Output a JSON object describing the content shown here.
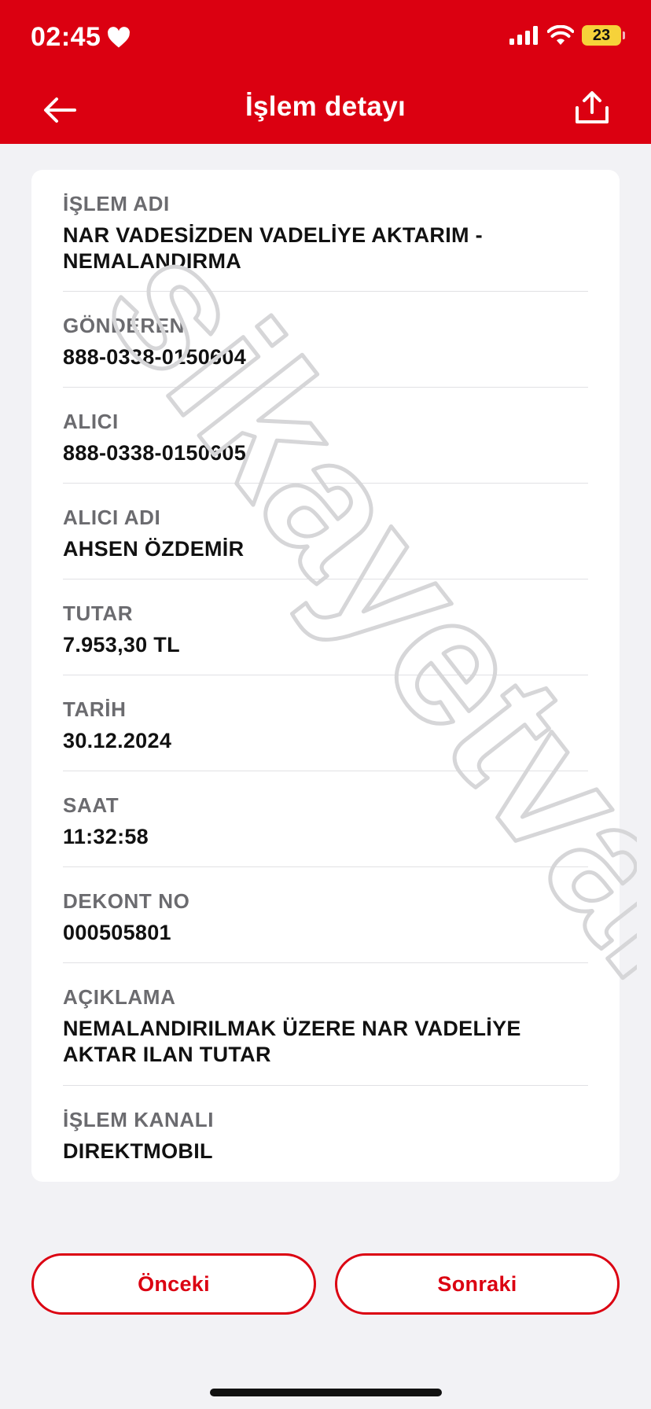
{
  "status_bar": {
    "time": "02:45",
    "battery": "23"
  },
  "header": {
    "title": "İşlem detayı"
  },
  "details": [
    {
      "label": "İŞLEM ADI",
      "value": "NAR VADESİZDEN VADELİYE AKTARIM -\nNEMALANDIRMA"
    },
    {
      "label": "GÖNDEREN",
      "value": "888-0338-0150604"
    },
    {
      "label": "ALICI",
      "value": "888-0338-0150605"
    },
    {
      "label": "ALICI ADI",
      "value": "AHSEN ÖZDEMİR"
    },
    {
      "label": "TUTAR",
      "value": "7.953,30 TL"
    },
    {
      "label": "TARİH",
      "value": "30.12.2024"
    },
    {
      "label": "SAAT",
      "value": "11:32:58"
    },
    {
      "label": "DEKONT NO",
      "value": "000505801"
    },
    {
      "label": "AÇIKLAMA",
      "value": "NEMALANDIRILMAK ÜZERE NAR VADELİYE\nAKTAR ILAN TUTAR"
    },
    {
      "label": "İŞLEM KANALI",
      "value": "DIREKTMOBIL"
    }
  ],
  "watermark": "sikayetvar",
  "buttons": {
    "previous": "Önceki",
    "next": "Sonraki"
  },
  "colors": {
    "brand_red": "#db0011",
    "background": "#f2f2f5",
    "label_gray": "#6b6b6f"
  },
  "icons": {
    "back": "arrow-left-icon",
    "share": "share-icon",
    "heart": "heart-icon",
    "signal": "cellular-signal-icon",
    "wifi": "wifi-icon",
    "battery": "battery-icon"
  }
}
